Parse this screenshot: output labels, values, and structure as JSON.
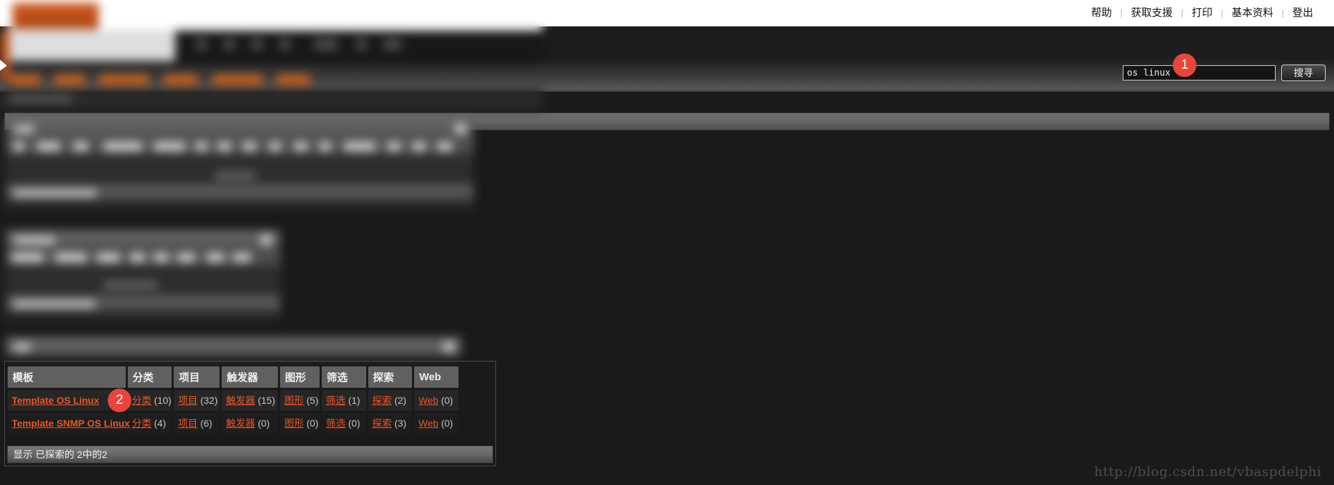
{
  "header": {
    "nav_links": [
      "帮助",
      "获取支援",
      "打印",
      "基本资料",
      "登出"
    ],
    "separator": "|"
  },
  "search": {
    "value": "os linux",
    "placeholder": "",
    "button_label": "搜寻",
    "badge": "1"
  },
  "table": {
    "columns": [
      "模板",
      "分类",
      "项目",
      "触发器",
      "图形",
      "筛选",
      "探索",
      "Web"
    ],
    "rows": [
      {
        "name": "Template OS Linux",
        "badge": "2",
        "cells": [
          {
            "label": "分类",
            "count": "(10)"
          },
          {
            "label": "项目",
            "count": "(32)"
          },
          {
            "label": "触发器",
            "count": "(15)"
          },
          {
            "label": "图形",
            "count": "(5)"
          },
          {
            "label": "筛选",
            "count": "(1)"
          },
          {
            "label": "探索",
            "count": "(2)"
          },
          {
            "label": "Web",
            "count": "(0)"
          }
        ]
      },
      {
        "name": "Template SNMP OS Linux",
        "badge": "",
        "cells": [
          {
            "label": "分类",
            "count": "(4)"
          },
          {
            "label": "项目",
            "count": "(6)"
          },
          {
            "label": "触发器",
            "count": "(0)"
          },
          {
            "label": "图形",
            "count": "(0)"
          },
          {
            "label": "筛选",
            "count": "(0)"
          },
          {
            "label": "探索",
            "count": "(3)"
          },
          {
            "label": "Web",
            "count": "(0)"
          }
        ]
      }
    ],
    "footer_text": "显示 已探索的 2中的2"
  },
  "watermark": {
    "text": "http://blog.csdn.net/vbaspdelphi"
  },
  "colors": {
    "accent_link": "#e8562a",
    "badge_red": "#e8453c",
    "panel_gray": "#606060",
    "page_bg": "#1a1a1a"
  }
}
